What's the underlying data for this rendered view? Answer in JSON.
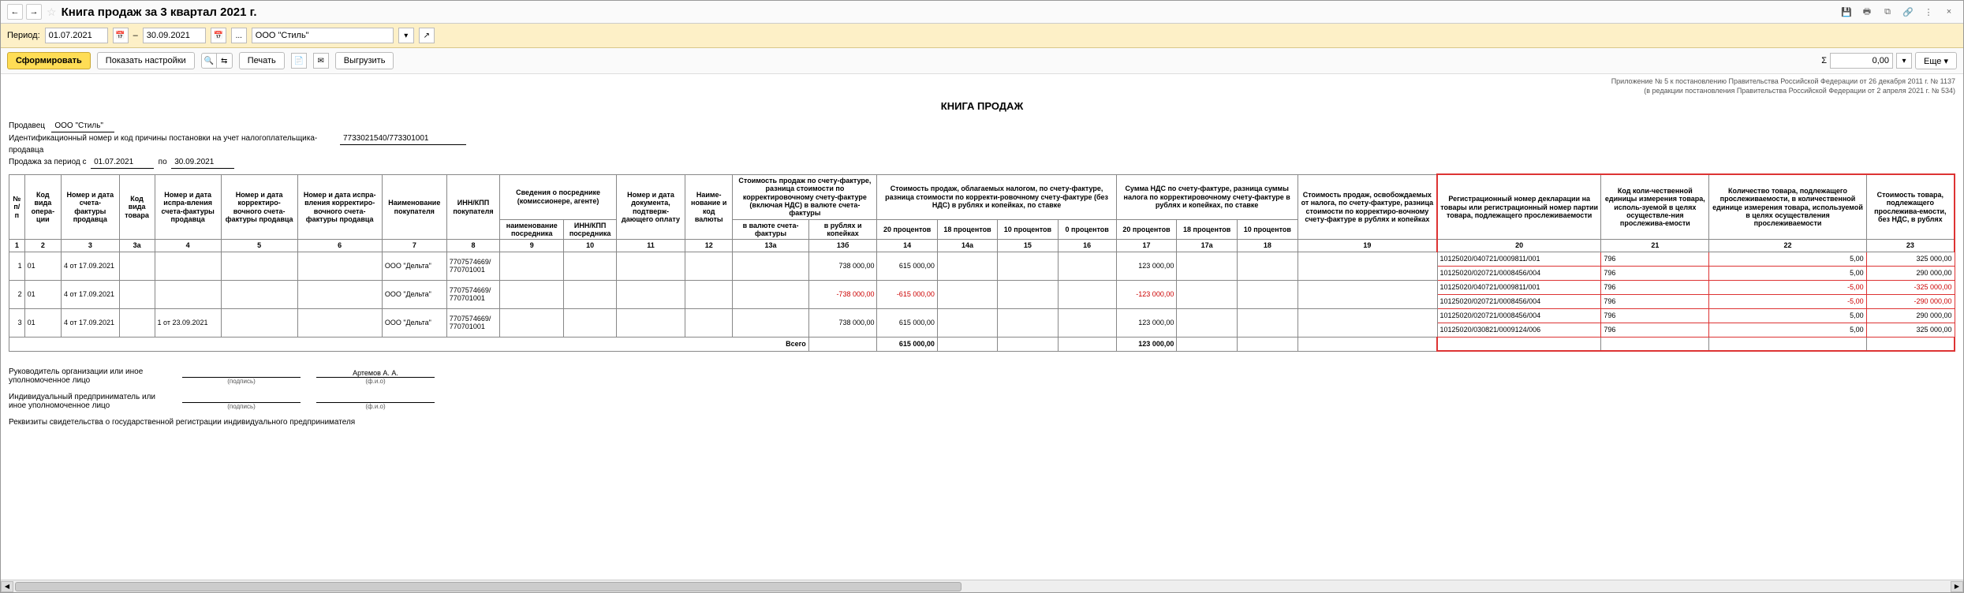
{
  "title": "Книга продаж за 3 квартал 2021 г.",
  "filter": {
    "period_label": "Период:",
    "date_from": "01.07.2021",
    "date_to": "30.09.2021",
    "sep": "–",
    "dots": "...",
    "org": "ООО \"Стиль\""
  },
  "toolbar": {
    "form": "Сформировать",
    "show_settings": "Показать настройки",
    "print": "Печать",
    "upload": "Выгрузить",
    "sum_sym": "Σ",
    "sum_val": "0,00",
    "more": "Еще"
  },
  "legal": {
    "l1": "Приложение № 5 к постановлению Правительства Российской Федерации от 26 декабря 2011 г. № 1137",
    "l2": "(в редакции постановления Правительства Российской Федерации от 2 апреля 2021 г. № 534)"
  },
  "report": {
    "title": "КНИГА ПРОДАЖ",
    "seller_lbl": "Продавец",
    "seller_val": "ООО \"Стиль\"",
    "inn_lbl": "Идентификационный номер и код причины постановки на учет налогоплательщика-продавца",
    "inn_val": "7733021540/773301001",
    "period_lbl": "Продажа за период с",
    "period_from": "01.07.2021",
    "period_to_lbl": "по",
    "period_to": "30.09.2021"
  },
  "cols": {
    "c1": "№ п/п",
    "c2": "Код вида опера-ции",
    "c3": "Номер и дата счета-фактуры продавца",
    "c3a": "Код вида товара",
    "c4": "Номер и дата испра-вления счета-фактуры продавца",
    "c5": "Номер и дата корректиро-вочного счета-фактуры продавца",
    "c6": "Номер и дата испра-вления корректиро-вочного счета-фактуры продавца",
    "c7": "Наименование покупателя",
    "c8": "ИНН/КПП покупателя",
    "c9g": "Сведения о посреднике (комиссионере, агенте)",
    "c9": "наименование посредника",
    "c10": "ИНН/КПП посредника",
    "c11": "Номер и дата документа, подтверж-дающего оплату",
    "c12": "Наиме-нование и код валюты",
    "c13g": "Стоимость продаж по счету-фактуре, разница стоимости по корректировочному счету-фактуре (включая НДС) в валюте счета-фактуры",
    "c13a": "в валюте счета-фактуры",
    "c13b": "в рублях и копейках",
    "c14g": "Стоимость продаж, облагаемых налогом, по счету-фактуре, разница стоимости по корректи-ровочному счету-фактуре (без НДС) в рублях и копейках, по ставке",
    "c14": "20 процентов",
    "c14a": "18 процентов",
    "c15": "10 процентов",
    "c16": "0 процентов",
    "c17g": "Сумма НДС по счету-фактуре, разница суммы налога по корректировочному счету-фактуре в рублях и копейках, по ставке",
    "c17": "20 процентов",
    "c17a": "18 процентов",
    "c18": "10 процентов",
    "c19": "Стоимость продаж, освобождаемых от налога, по счету-фактуре, разница стоимости по корректиро-вочному счету-фактуре в рублях и копейках",
    "c20": "Регистрационный номер декларации на товары или регистрационный номер партии товара, подлежащего прослеживаемости",
    "c21": "Код коли-чественной единицы измерения товара, исполь-зуемой в целях осуществле-ния прослежива-емости",
    "c22": "Количество товара, подлежащего прослеживаемости, в количественной единице измерения товара, используемой в целях осуществления прослеживаемости",
    "c23": "Стоимость товара, подлежащего прослежива-емости, без НДС, в рублях"
  },
  "colnums": {
    "n1": "1",
    "n2": "2",
    "n3": "3",
    "n3a": "3а",
    "n4": "4",
    "n5": "5",
    "n6": "6",
    "n7": "7",
    "n8": "8",
    "n9": "9",
    "n10": "10",
    "n11": "11",
    "n12": "12",
    "n13a": "13а",
    "n13b": "13б",
    "n14": "14",
    "n14a": "14а",
    "n15": "15",
    "n16": "16",
    "n17": "17",
    "n17a": "17а",
    "n18": "18",
    "n19": "19",
    "n20": "20",
    "n21": "21",
    "n22": "22",
    "n23": "23"
  },
  "rows": [
    {
      "n": "1",
      "code": "01",
      "invoice": "4 от 17.09.2021",
      "corr": "",
      "buyer": "ООО \"Дельта\"",
      "inn": "7707574669/ 770701001",
      "sum_rub": "738 000,00",
      "base20": "615 000,00",
      "vat20": "123 000,00",
      "tracks": [
        {
          "reg": "10125020/040721/0009811/001",
          "unit": "796",
          "qty": "5,00",
          "cost": "325 000,00"
        },
        {
          "reg": "10125020/020721/0008456/004",
          "unit": "796",
          "qty": "5,00",
          "cost": "290 000,00"
        }
      ]
    },
    {
      "n": "2",
      "code": "01",
      "invoice": "4 от 17.09.2021",
      "corr": "",
      "buyer": "ООО \"Дельта\"",
      "inn": "7707574669/ 770701001",
      "sum_rub": "-738 000,00",
      "base20": "-615 000,00",
      "vat20": "-123 000,00",
      "neg": true,
      "tracks": [
        {
          "reg": "10125020/040721/0009811/001",
          "unit": "796",
          "qty": "-5,00",
          "cost": "-325 000,00",
          "neg": true
        },
        {
          "reg": "10125020/020721/0008456/004",
          "unit": "796",
          "qty": "-5,00",
          "cost": "-290 000,00",
          "neg": true
        }
      ]
    },
    {
      "n": "3",
      "code": "01",
      "invoice": "4 от 17.09.2021",
      "corr": "1 от 23.09.2021",
      "buyer": "ООО \"Дельта\"",
      "inn": "7707574669/ 770701001",
      "sum_rub": "738 000,00",
      "base20": "615 000,00",
      "vat20": "123 000,00",
      "tracks": [
        {
          "reg": "10125020/020721/0008456/004",
          "unit": "796",
          "qty": "5,00",
          "cost": "290 000,00"
        },
        {
          "reg": "10125020/030821/0009124/006",
          "unit": "796",
          "qty": "5,00",
          "cost": "325 000,00"
        }
      ]
    }
  ],
  "totals": {
    "label": "Всего",
    "base20": "615 000,00",
    "vat20": "123 000,00"
  },
  "sign": {
    "head_lbl": "Руководитель организации или иное уполномоченное лицо",
    "sign_sub": "(подпись)",
    "fio_sub": "(ф.и.о)",
    "head_name": "Артемов А. А.",
    "ip_lbl": "Индивидуальный предприниматель или иное уполномоченное лицо",
    "req_lbl": "Реквизиты свидетельства о государственной регистрации индивидуального предпринимателя"
  }
}
